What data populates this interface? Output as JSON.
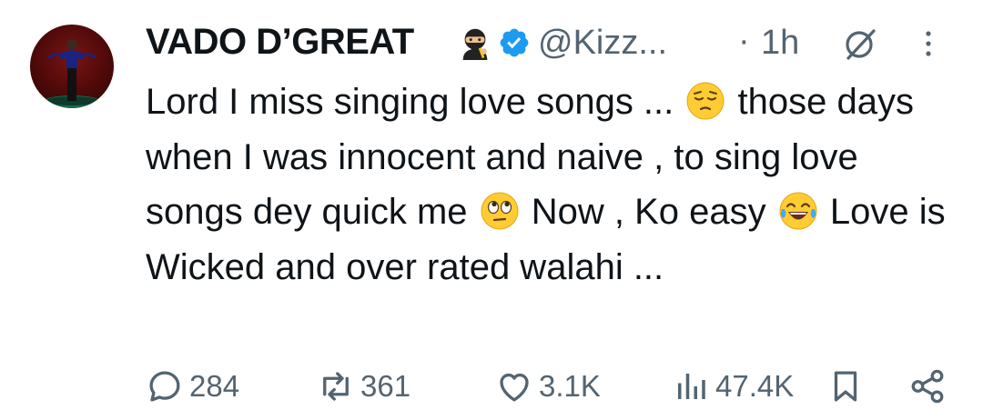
{
  "tweet": {
    "author_name": "VADO D’GREAT",
    "handle": "@Kizz...",
    "separator": "·",
    "time": "1h",
    "text_segments": [
      "Lord I miss singing love songs ... ",
      " those days when I was innocent and naive , to sing love songs dey quick me ",
      " Now , Ko easy ",
      " Love is Wicked and over rated walahi ..."
    ],
    "emojis": [
      "pensive-face",
      "face-with-rolling-eyes",
      "face-with-tears-of-joy"
    ],
    "author_emoji": "ninja",
    "verified": true
  },
  "actions": {
    "replies": "284",
    "reposts": "361",
    "likes": "3.1K",
    "views": "47.4K"
  },
  "colors": {
    "text": "#0f1419",
    "muted": "#536471",
    "verified_blue": "#1d9bf0",
    "emoji_yellow": "#ffcc33"
  },
  "icons": [
    "reply-icon",
    "repost-icon",
    "like-icon",
    "views-icon",
    "bookmark-icon",
    "share-icon",
    "grok-icon",
    "more-icon",
    "verified-icon"
  ]
}
